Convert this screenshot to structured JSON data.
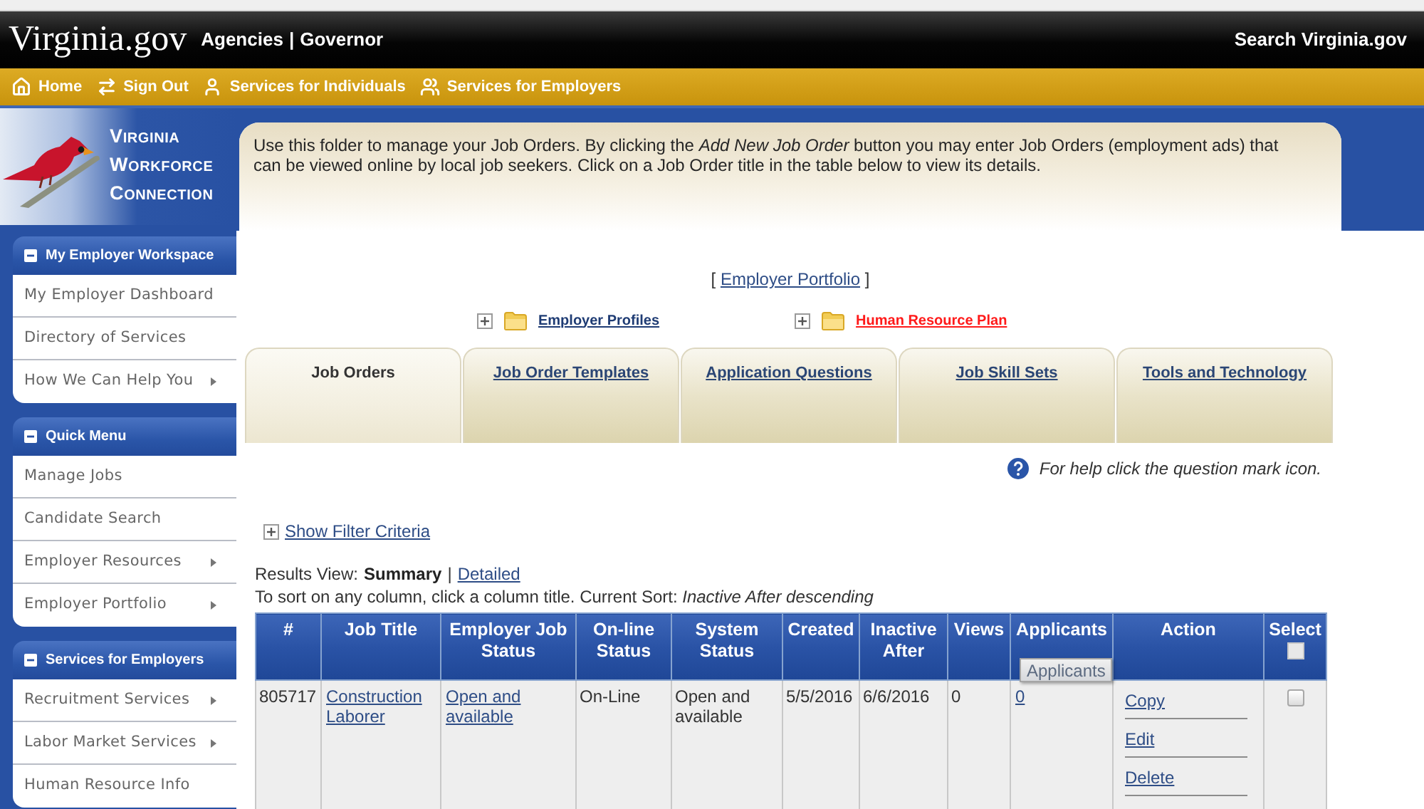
{
  "header": {
    "logo": "Virginia.gov",
    "links": [
      "Agencies",
      "Governor"
    ],
    "separator": "|",
    "search": "Search Virginia.gov"
  },
  "nav": [
    {
      "kind": "home",
      "label": "Home"
    },
    {
      "kind": "sign_out",
      "label": "Sign Out"
    },
    {
      "kind": "person",
      "label": "Services for Individuals"
    },
    {
      "kind": "people",
      "label": "Services for Employers"
    }
  ],
  "sidebar": {
    "brand": [
      "VIRGINIA",
      "WORKFORCE",
      "CONNECTION"
    ],
    "sections": [
      {
        "title": "My Employer Workspace",
        "expanded": true,
        "items": [
          {
            "label": "My Employer Dashboard",
            "submenu": false
          },
          {
            "label": "Directory of Services",
            "submenu": false
          },
          {
            "label": "How We Can Help You",
            "submenu": true
          }
        ]
      },
      {
        "title": "Quick Menu",
        "expanded": true,
        "items": [
          {
            "label": "Manage Jobs",
            "submenu": false
          },
          {
            "label": "Candidate Search",
            "submenu": false
          },
          {
            "label": "Employer Resources",
            "submenu": true
          },
          {
            "label": "Employer Portfolio",
            "submenu": true
          }
        ]
      },
      {
        "title": "Services for Employers",
        "expanded": true,
        "items": [
          {
            "label": "Recruitment Services",
            "submenu": true
          },
          {
            "label": "Labor Market Services",
            "submenu": true
          },
          {
            "label": "Human Resource Info",
            "submenu": false
          }
        ]
      }
    ]
  },
  "intro": "Use this folder to manage your Job Orders. By clicking the *Add New Job Order* button you may enter Job Orders (employment ads) that can be viewed online by local job seekers. Click on a Job Order title in the table below to view its details.",
  "portfolio": {
    "open": "[",
    "label": "Employer Portfolio",
    "close": "]"
  },
  "folders": [
    {
      "label": "Employer Profiles",
      "expanded": false,
      "color": "#1f3c74"
    },
    {
      "label": "Human Resource Plan",
      "expanded": false,
      "color": "#ff1a1a"
    }
  ],
  "tabs": [
    {
      "label": "Job Orders",
      "selected": true
    },
    {
      "label": "Job Order Templates",
      "selected": false
    },
    {
      "label": "Application Questions",
      "selected": false
    },
    {
      "label": "Job Skill Sets",
      "selected": false
    },
    {
      "label": "Tools and Technology",
      "selected": false
    }
  ],
  "help": "For help click the question mark icon.",
  "filter": {
    "label": "Show Filter Criteria",
    "expanded": false
  },
  "results_view": {
    "label": "Results View:",
    "separator": "|",
    "options": [
      {
        "label": "Summary",
        "selected": true
      },
      {
        "label": "Detailed",
        "selected": false
      }
    ]
  },
  "sort_note": "To sort on any column, click a column title. Current Sort: *Inactive After descending*",
  "table": {
    "columns": [
      {
        "label": "#"
      },
      {
        "label": "Job Title"
      },
      {
        "label": "Employer Job Status"
      },
      {
        "label": "On-line Status"
      },
      {
        "label": "System Status"
      },
      {
        "label": "Created"
      },
      {
        "label": "Inactive After"
      },
      {
        "label": "Views"
      },
      {
        "label": "Applicants",
        "tooltip": "Applicants"
      },
      {
        "label": "Action"
      },
      {
        "label": "Select",
        "select_all": false
      }
    ],
    "rows": [
      {
        "cells": [
          {
            "kind": "text",
            "text": "805717"
          },
          {
            "kind": "link",
            "text": "Construction Laborer"
          },
          {
            "kind": "link",
            "text": "Open and available"
          },
          {
            "kind": "text",
            "text": "On-Line"
          },
          {
            "kind": "text",
            "text": "Open and available"
          },
          {
            "kind": "text",
            "text": "5/5/2016"
          },
          {
            "kind": "text",
            "text": "6/6/2016"
          },
          {
            "kind": "text",
            "text": "0"
          },
          {
            "kind": "link",
            "text": "0"
          },
          {
            "kind": "actions",
            "links": [
              "Copy",
              "Edit",
              "Delete"
            ]
          },
          {
            "kind": "checkbox",
            "checked": false
          }
        ]
      }
    ]
  }
}
